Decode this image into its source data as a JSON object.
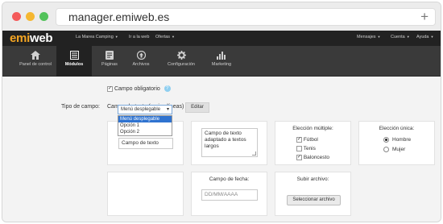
{
  "browser": {
    "url": "manager.emiweb.es"
  },
  "brand": {
    "logo_left": "emi",
    "logo_right": "web"
  },
  "topnav": {
    "left": [
      "La Marea Camping",
      "Ir a la web",
      "Ofertas"
    ],
    "right": [
      "Mensajes",
      "Cuenta",
      "Ayuda"
    ]
  },
  "modules": [
    {
      "label": "Panel de control",
      "icon": "home-icon"
    },
    {
      "label": "Módulos",
      "icon": "list-icon"
    },
    {
      "label": "Páginas",
      "icon": "pages-icon"
    },
    {
      "label": "Archivos",
      "icon": "upload-icon"
    },
    {
      "label": "Configuración",
      "icon": "gear-icon"
    },
    {
      "label": "Marketing",
      "icon": "bar-chart-icon"
    }
  ],
  "form": {
    "obligatorio": "Campo obligatorio",
    "help": "?",
    "tipo_label": "Tipo de campo:",
    "tipo_value": "Campo de texto (varias líneas)",
    "editar": "Editar",
    "check_mark": "✓"
  },
  "cards": {
    "texto_value": "Campo de texto",
    "textarea_value": "Campo de texto adaptado a textos largos",
    "multiple": {
      "title": "Elección múltiple:",
      "options": [
        "Fútbol",
        "Tenis",
        "Baloncesto"
      ],
      "checked": [
        true,
        false,
        true
      ]
    },
    "unica": {
      "title": "Elección única:",
      "options": [
        "Hombre",
        "Mujer"
      ],
      "selected": 0
    },
    "select": {
      "value": "Menú desplegable",
      "arrow": "▾",
      "options": [
        "Menú desplegable",
        "Opción 1",
        "Opción 2"
      ]
    },
    "fecha": {
      "title": "Campo de fecha:",
      "placeholder": "DD/MM/AAAA"
    },
    "archivo": {
      "title": "Subir archivo:",
      "button": "Seleccionar archivo"
    }
  },
  "colors": {
    "logo_accent": "#f5a623",
    "topbar": "#222222",
    "modbar": "#3a3a3a",
    "select_highlight": "#2f73d0"
  }
}
